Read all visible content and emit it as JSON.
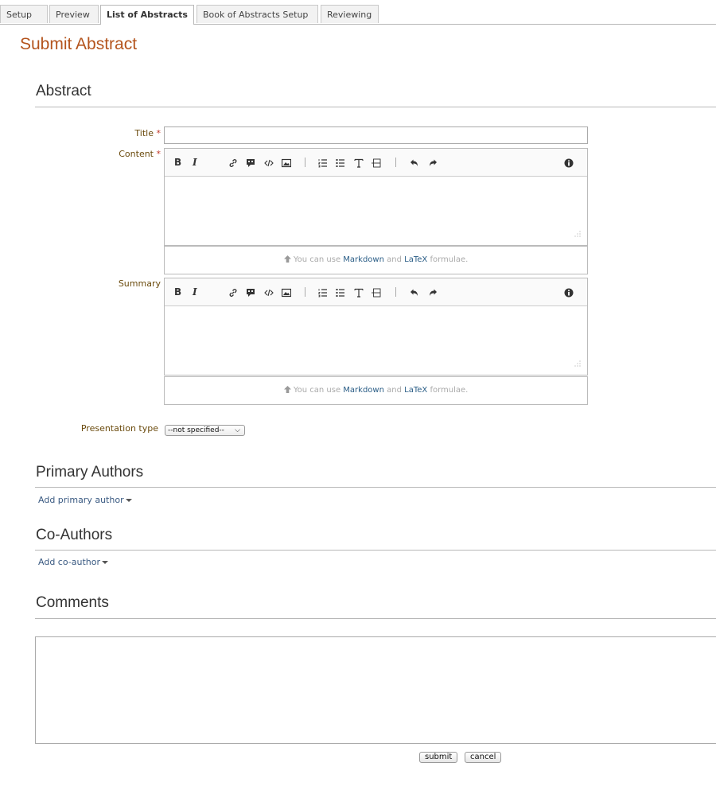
{
  "tabs": [
    {
      "label": "Setup"
    },
    {
      "label": "Preview"
    },
    {
      "label": "List of Abstracts",
      "active": true
    },
    {
      "label": "Book of Abstracts Setup"
    },
    {
      "label": "Reviewing"
    }
  ],
  "page_title": "Submit Abstract",
  "abstract_section": {
    "heading": "Abstract",
    "title_label": "Title",
    "content_label": "Content",
    "summary_label": "Summary",
    "required_mark": "*",
    "presentation_type_label": "Presentation type",
    "presentation_type_value": "--not specified--"
  },
  "editor": {
    "bold": "B",
    "italic": "I",
    "hint_prefix": "You can use",
    "hint_markdown": "Markdown",
    "hint_and": "and",
    "hint_latex": "LaTeX",
    "hint_suffix": "formulae."
  },
  "primary_authors": {
    "heading": "Primary Authors",
    "add_link": "Add primary author"
  },
  "co_authors": {
    "heading": "Co-Authors",
    "add_link": "Add co-author"
  },
  "comments": {
    "heading": "Comments"
  },
  "buttons": {
    "submit": "submit",
    "cancel": "cancel"
  }
}
